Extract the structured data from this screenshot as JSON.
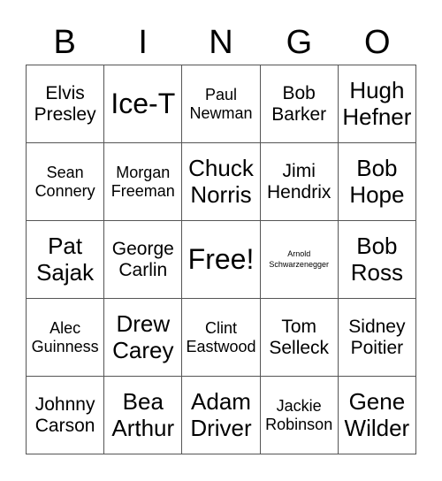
{
  "header": [
    "B",
    "I",
    "N",
    "G",
    "O"
  ],
  "cells": [
    {
      "text": "Elvis Presley",
      "size": "m"
    },
    {
      "text": "Ice-T",
      "size": "xl"
    },
    {
      "text": "Paul Newman",
      "size": "sm"
    },
    {
      "text": "Bob Barker",
      "size": "m"
    },
    {
      "text": "Hugh Hefner",
      "size": "l"
    },
    {
      "text": "Sean Connery",
      "size": "sm"
    },
    {
      "text": "Morgan Freeman",
      "size": "sm"
    },
    {
      "text": "Chuck Norris",
      "size": "l"
    },
    {
      "text": "Jimi Hendrix",
      "size": "m"
    },
    {
      "text": "Bob Hope",
      "size": "l"
    },
    {
      "text": "Pat Sajak",
      "size": "l"
    },
    {
      "text": "George Carlin",
      "size": "m"
    },
    {
      "text": "Free!",
      "size": "xl"
    },
    {
      "text": "Arnold Schwarzenegger",
      "size": "xs"
    },
    {
      "text": "Bob Ross",
      "size": "l"
    },
    {
      "text": "Alec Guinness",
      "size": "sm"
    },
    {
      "text": "Drew Carey",
      "size": "l"
    },
    {
      "text": "Clint Eastwood",
      "size": "sm"
    },
    {
      "text": "Tom Selleck",
      "size": "m"
    },
    {
      "text": "Sidney Poitier",
      "size": "m"
    },
    {
      "text": "Johnny Carson",
      "size": "m"
    },
    {
      "text": "Bea Arthur",
      "size": "l"
    },
    {
      "text": "Adam Driver",
      "size": "l"
    },
    {
      "text": "Jackie Robinson",
      "size": "sm"
    },
    {
      "text": "Gene Wilder",
      "size": "l"
    }
  ]
}
